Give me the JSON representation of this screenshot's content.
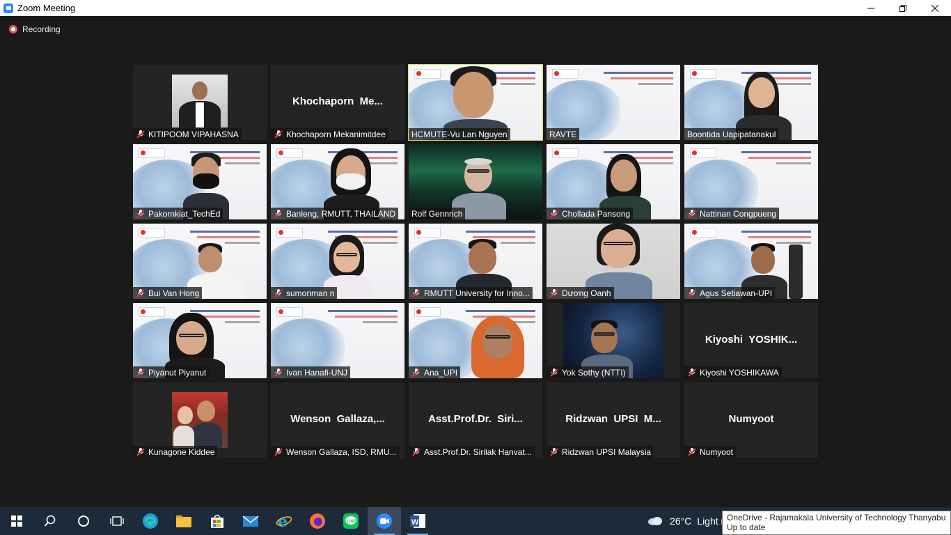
{
  "window": {
    "title": "Zoom Meeting"
  },
  "recording": {
    "label": "Recording"
  },
  "participants": [
    {
      "name": "KITIPOOM VIPAHASNA"
    },
    {
      "name": "Khochaporn Mekanimitdee",
      "big_label": "Khochaporn  Me..."
    },
    {
      "name": "HCMUTE-Vu Lan Nguyen"
    },
    {
      "name": "RAVTE"
    },
    {
      "name": "Boontida Uapipatanakul"
    },
    {
      "name": "Pakornkiat_TechEd"
    },
    {
      "name": "Banleng, RMUTT, THAILAND"
    },
    {
      "name": "Rolf Gennrich"
    },
    {
      "name": "Chollada Pansong"
    },
    {
      "name": "Nattinan Congpueng"
    },
    {
      "name": "Bui Van Hong"
    },
    {
      "name": "sumonman n"
    },
    {
      "name": "RMUTT University for Inno..."
    },
    {
      "name": "Dương Oanh"
    },
    {
      "name": "Agus Setiawan-UPI"
    },
    {
      "name": "Piyanut Piyanut"
    },
    {
      "name": "Ivan Hanafi-UNJ"
    },
    {
      "name": "Ana_UPI"
    },
    {
      "name": "Yok Sothy (NTTI)"
    },
    {
      "name": "Kiyoshi YOSHIKAWA",
      "big_label": "Kiyoshi  YOSHIK..."
    },
    {
      "name": "Kunagone Kiddee"
    },
    {
      "name": "Wenson Gallaza, ISD, RMU...",
      "big_label": "Wenson  Gallaza,..."
    },
    {
      "name": "Asst.Prof.Dr. Sirilak Hanvat...",
      "big_label": "Asst.Prof.Dr.  Siri..."
    },
    {
      "name": "Ridzwan UPSI Malaysia",
      "big_label": "Ridzwan  UPSI  M..."
    },
    {
      "name": "Numyoot",
      "big_label": "Numyoot"
    }
  ],
  "taskbar": {
    "weather": {
      "temp": "26°C",
      "desc": "Light r"
    }
  },
  "notification": {
    "line1": "OneDrive - Rajamakala University of Technology Thanyaburi",
    "line2": "Up to date"
  }
}
